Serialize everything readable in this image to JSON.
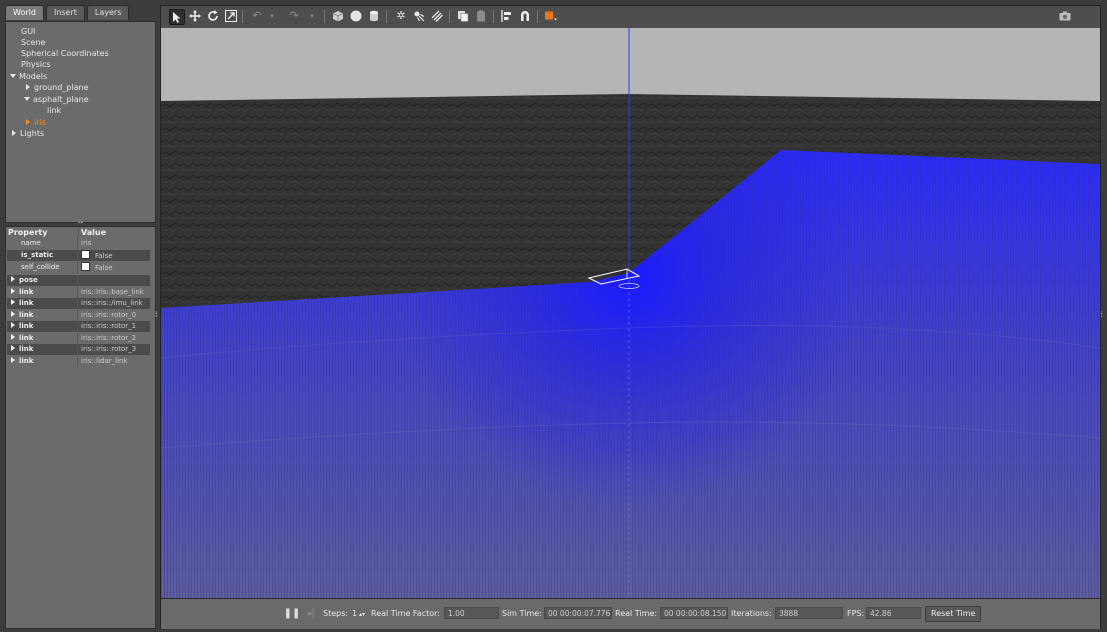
{
  "tabs": [
    "World",
    "Insert",
    "Layers"
  ],
  "tree": {
    "gui": "GUI",
    "scene": "Scene",
    "spherical": "Spherical Coordinates",
    "physics": "Physics",
    "models": "Models",
    "ground_plane": "ground_plane",
    "asphalt_plane": "asphalt_plane",
    "link": "link",
    "iris": "iris",
    "lights": "Lights"
  },
  "properties": {
    "header_property": "Property",
    "header_value": "Value",
    "rows": [
      {
        "key": "name",
        "value": "iris"
      },
      {
        "key": "is_static",
        "value": "False"
      },
      {
        "key": "self_collide",
        "value": "False"
      },
      {
        "key": "pose",
        "value": ""
      },
      {
        "key": "link",
        "value": "iris::iris::base_link"
      },
      {
        "key": "link",
        "value": "iris::iris::/imu_link"
      },
      {
        "key": "link",
        "value": "iris::iris::rotor_0"
      },
      {
        "key": "link",
        "value": "iris::iris::rotor_1"
      },
      {
        "key": "link",
        "value": "iris::iris::rotor_2"
      },
      {
        "key": "link",
        "value": "iris::iris::rotor_3"
      },
      {
        "key": "link",
        "value": "iris::lidar_link"
      }
    ]
  },
  "toolbar": {
    "icons": [
      "select-arrow-icon",
      "translate-icon",
      "rotate-icon",
      "scale-icon",
      "undo-icon",
      "undo-menu-icon",
      "redo-icon",
      "redo-menu-icon",
      "box-icon",
      "sphere-icon",
      "cylinder-icon",
      "point-light-icon",
      "spot-light-icon",
      "directional-light-icon",
      "copy-icon",
      "paste-icon",
      "align-icon",
      "snap-icon",
      "view-angle-icon",
      "screenshot-icon"
    ]
  },
  "status": {
    "steps_label": "Steps:",
    "steps_value": "1",
    "rtf_label": "Real Time Factor:",
    "rtf_value": "1.00",
    "sim_label": "Sim Time:",
    "sim_value": "00 00:00:07.776",
    "real_label": "Real Time:",
    "real_value": "00 00:00:08.150",
    "iter_label": "Iterations:",
    "iter_value": "3888",
    "fps_label": "FPS:",
    "fps_value": "42.86",
    "reset_label": "Reset Time"
  },
  "colors": {
    "selected_item": "#ff8a1a",
    "lidar_blue": "#1a1aff",
    "sky": "#b5b5b5"
  }
}
